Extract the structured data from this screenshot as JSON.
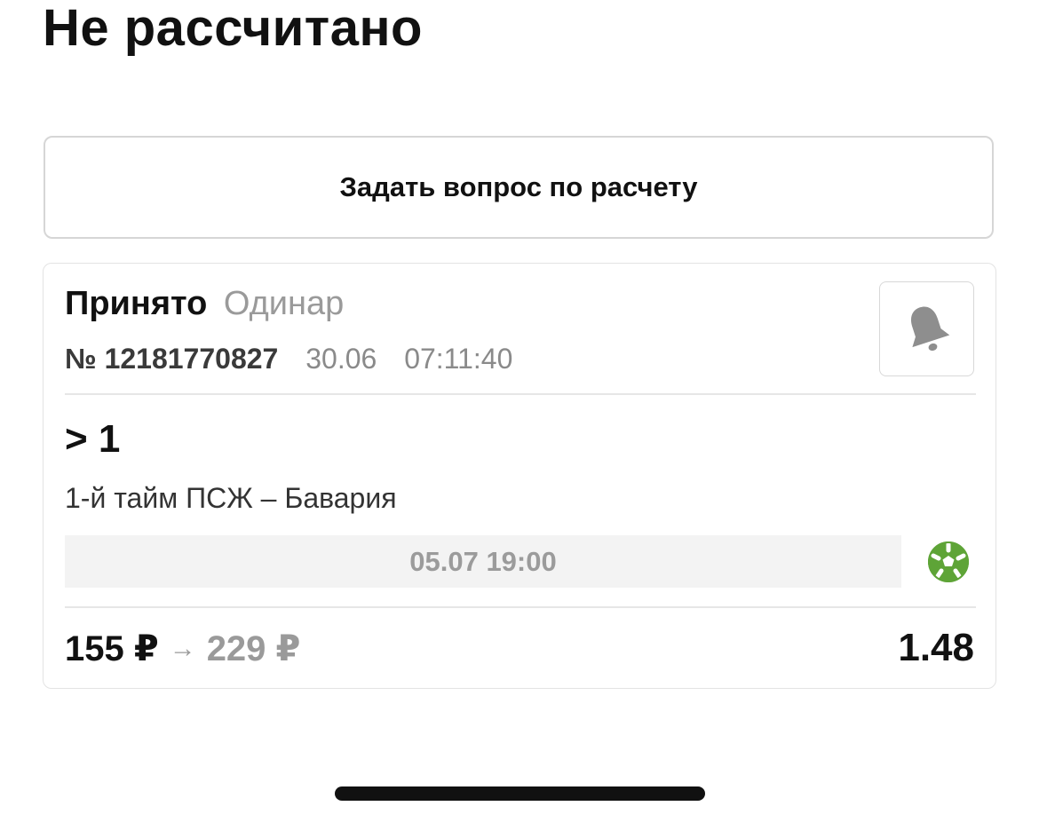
{
  "header": {
    "title": "Не рассчитано"
  },
  "actions": {
    "ask_label": "Задать вопрос по расчету"
  },
  "bet": {
    "status": "Принято",
    "type": "Одинар",
    "number": "№ 12181770827",
    "date": "30.06",
    "time": "07:11:40",
    "outcome": "> 1",
    "event": "1-й тайм ПСЖ – Бавария",
    "event_datetime": "05.07 19:00",
    "stake": "155 ₽",
    "arrow": "→",
    "payout": "229 ₽",
    "odds": "1.48",
    "sport_icon": "soccer-ball-icon",
    "bell_icon": "bell-icon"
  },
  "colors": {
    "text_primary": "#111111",
    "text_muted": "#9a9a9a",
    "sport_green": "#5ea437",
    "bell_gray": "#8e8e8e"
  }
}
